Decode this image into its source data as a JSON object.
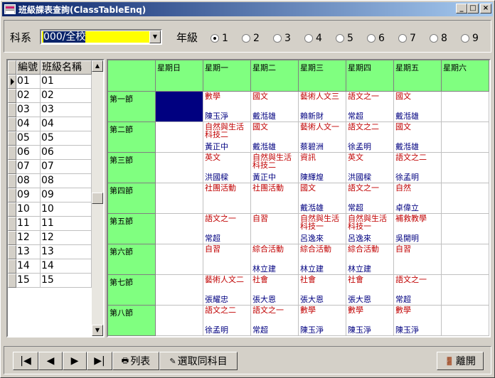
{
  "window": {
    "title": "班級課表查詢(ClassTableEnq)",
    "min": "_",
    "max": "□",
    "close": "×"
  },
  "filter": {
    "dept_label": "科系",
    "dept_value": "000/全校",
    "grade_label": "年級",
    "grades": [
      "1",
      "2",
      "3",
      "4",
      "5",
      "6",
      "7",
      "8",
      "9"
    ],
    "selected_grade": "1"
  },
  "classlist": {
    "headers": [
      "編號",
      "班級名稱"
    ],
    "rows": [
      [
        "01",
        "01"
      ],
      [
        "02",
        "02"
      ],
      [
        "03",
        "03"
      ],
      [
        "04",
        "04"
      ],
      [
        "05",
        "05"
      ],
      [
        "06",
        "06"
      ],
      [
        "07",
        "07"
      ],
      [
        "08",
        "08"
      ],
      [
        "09",
        "09"
      ],
      [
        "10",
        "10"
      ],
      [
        "11",
        "11"
      ],
      [
        "12",
        "12"
      ],
      [
        "13",
        "13"
      ],
      [
        "14",
        "14"
      ],
      [
        "15",
        "15"
      ]
    ]
  },
  "timetable": {
    "days": [
      "星期日",
      "星期一",
      "星期二",
      "星期三",
      "星期四",
      "星期五",
      "星期六"
    ],
    "periods": [
      "第一節",
      "第二節",
      "第三節",
      "第四節",
      "第五節",
      "第六節",
      "第七節",
      "第八節"
    ],
    "cells": [
      [
        [
          "",
          ""
        ],
        [
          "數學",
          "陳玉淨"
        ],
        [
          "國文",
          "戴湉雄"
        ],
        [
          "藝術人文三",
          "賴新財"
        ],
        [
          "語文之一",
          "常超"
        ],
        [
          "國文",
          "戴湉雄"
        ],
        [
          "",
          ""
        ]
      ],
      [
        [
          "",
          ""
        ],
        [
          "自然與生活科技二",
          "黃正中"
        ],
        [
          "國文",
          "戴湉雄"
        ],
        [
          "藝術人文一",
          "蔡碧洲"
        ],
        [
          "語文之二",
          "徐孟明"
        ],
        [
          "國文",
          "戴湉雄"
        ],
        [
          "",
          ""
        ]
      ],
      [
        [
          "",
          ""
        ],
        [
          "英文",
          "洪國樑"
        ],
        [
          "自然與生活科技二",
          "黃正中"
        ],
        [
          "資訊",
          "陳輝煌"
        ],
        [
          "英文",
          "洪國樑"
        ],
        [
          "語文之二",
          "徐孟明"
        ],
        [
          "",
          ""
        ]
      ],
      [
        [
          "",
          ""
        ],
        [
          "社團活動",
          ""
        ],
        [
          "社團活動",
          ""
        ],
        [
          "國文",
          "戴湉雄"
        ],
        [
          "語文之一",
          "常超"
        ],
        [
          "自然",
          "卓偉立"
        ],
        [
          "",
          ""
        ]
      ],
      [
        [
          "",
          ""
        ],
        [
          "語文之一",
          "常超"
        ],
        [
          "自習",
          ""
        ],
        [
          "自然與生活科技一",
          "呂逸來"
        ],
        [
          "自然與生活科技一",
          "呂逸來"
        ],
        [
          "補救教學",
          "吳開明"
        ],
        [
          "",
          ""
        ]
      ],
      [
        [
          "",
          ""
        ],
        [
          "自習",
          ""
        ],
        [
          "綜合活動",
          "林立建"
        ],
        [
          "綜合活動",
          "林立建"
        ],
        [
          "綜合活動",
          "林立建"
        ],
        [
          "自習",
          ""
        ],
        [
          "",
          ""
        ]
      ],
      [
        [
          "",
          ""
        ],
        [
          "藝術人文二",
          "張耀忠"
        ],
        [
          "社會",
          "張大恩"
        ],
        [
          "社會",
          "張大恩"
        ],
        [
          "社會",
          "張大恩"
        ],
        [
          "語文之一",
          "常超"
        ],
        [
          "",
          ""
        ]
      ],
      [
        [
          "",
          ""
        ],
        [
          "語文之二",
          "徐孟明"
        ],
        [
          "語文之一",
          "常超"
        ],
        [
          "數學",
          "陳玉淨"
        ],
        [
          "數學",
          "陳玉淨"
        ],
        [
          "數學",
          "陳玉淨"
        ],
        [
          "",
          ""
        ]
      ]
    ]
  },
  "buttons": {
    "first": "|◀",
    "prev": "◀",
    "next": "▶",
    "last": "▶|",
    "list": "列表",
    "select_same": "選取同科目",
    "exit": "離開"
  },
  "colors": {
    "header_green": "#80ff80",
    "subject_red": "#c00000",
    "teacher_navy": "#000080",
    "combo_yellow": "#ffff00"
  }
}
